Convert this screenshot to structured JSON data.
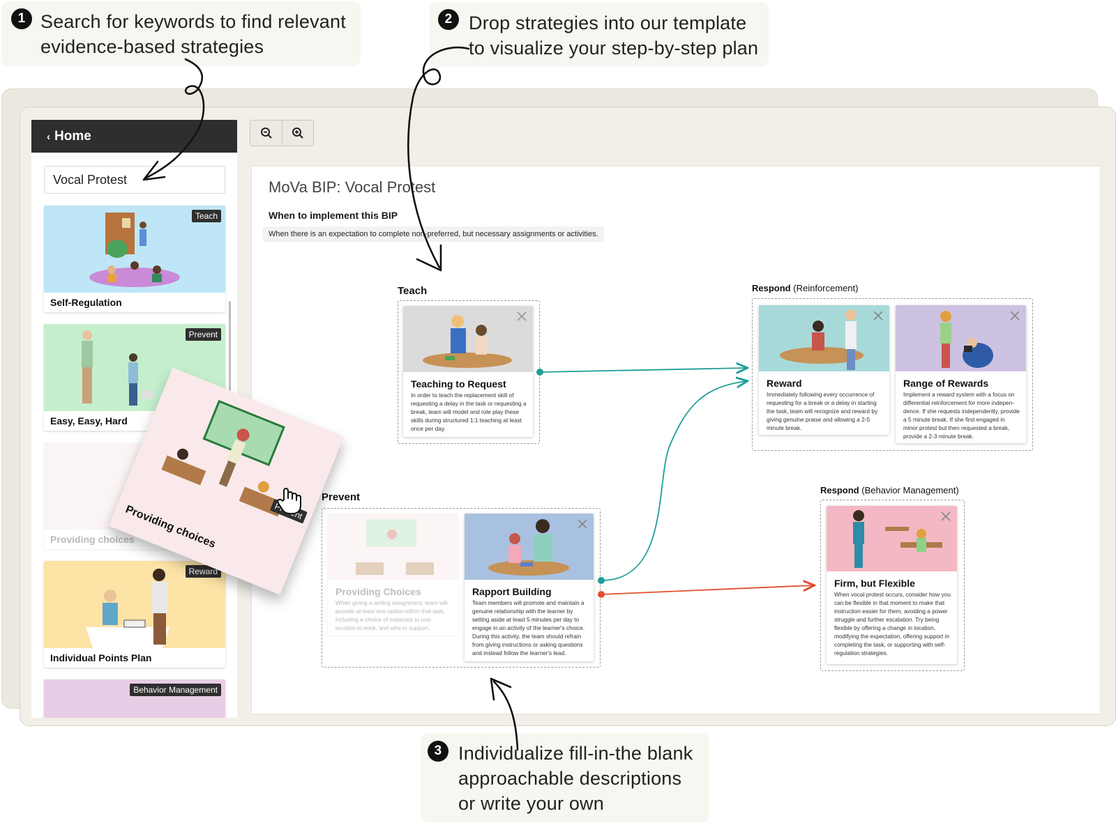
{
  "callouts": [
    {
      "num": "1",
      "line1": "Search for keywords to find relevant",
      "line2": "evidence-based strategies"
    },
    {
      "num": "2",
      "line1": "Drop strategies into our template",
      "line2": "to visualize your step-by-step plan"
    },
    {
      "num": "3",
      "line1": "Individualize fill-in-the blank",
      "line2": "approachable descriptions",
      "line3": "or write your own"
    }
  ],
  "sidebar": {
    "home_label": "Home",
    "search_value": "Vocal Protest",
    "cards": [
      {
        "label": "Self-Regulation",
        "tag": "Teach"
      },
      {
        "label": "Easy, Easy, Hard",
        "tag": "Prevent"
      },
      {
        "label": "Providing choices",
        "tag": ""
      },
      {
        "label": "Individual Points Plan",
        "tag": "Reward"
      },
      {
        "label": "",
        "tag": "Behavior Management"
      }
    ]
  },
  "drag_card": {
    "label": "Providing choices",
    "tag": "Prevent"
  },
  "toolbar": {
    "zoom_out": "zoom-out",
    "zoom_in": "zoom-in"
  },
  "plan": {
    "title": "MoVa BIP: Vocal Protest",
    "when_heading": "When to implement this BIP",
    "when_text": "When there is an expectation to complete non-preferred, but necessary assignments or activities."
  },
  "sections": {
    "teach": {
      "label": "Teach"
    },
    "prevent": {
      "label": "Prevent"
    },
    "respond_reinf": {
      "label": "Respond",
      "sub": "(Reinforcement)"
    },
    "respond_bm": {
      "label": "Respond",
      "sub": "(Behavior Management)"
    }
  },
  "strategies": {
    "teaching_to_request": {
      "title": "Teaching to Request",
      "desc": "In order to teach the replacement skill of requesting a delay in the task or requesting a break, team will model and role play these skills during structured 1:1 teaching at least once per day."
    },
    "providing_choices": {
      "title": "Providing Choices",
      "desc": "When giving a writing assignment, team will provide at least one option within that task, including a choice of materials to use, location to work, and who to support."
    },
    "rapport_building": {
      "title": "Rapport Building",
      "desc": "Team members will promote and maintain a genuine relationship with the learner by setting aside at least 5 minutes per day to engage in an activity of the learner's choice. During this activity, the team should refrain from giving instructions or asking questions and instead follow the learner's lead."
    },
    "reward": {
      "title": "Reward",
      "desc": "Immediately following every occurrence of requesting for a break or a delay in starting the task, team will recognize and reward by giving genuine praise and allowing a 2-5 minute break."
    },
    "range_of_rewards": {
      "title": "Range of Rewards",
      "desc": "Implement a reward system with a focus on differential reinforcement for more indepen- dence. If she requests independently, provide a 5 minute break. If she first engaged in minor protest but then requested a break, provide a 2-3 minute break."
    },
    "firm_but_flexible": {
      "title": "Firm, but Flexible",
      "desc": "When vocal protest occurs, consider how you can be flexible in that moment to make that instruction easier for them, avoiding a power struggle and further escalation. Try being flexible by offering a change in location, modifying the expectation, offering support in completing the task, or supporting with self-regulation strategies."
    }
  },
  "colors": {
    "teal": "#1f9e97",
    "red": "#e0502f",
    "dark": "#2e2e2e"
  }
}
